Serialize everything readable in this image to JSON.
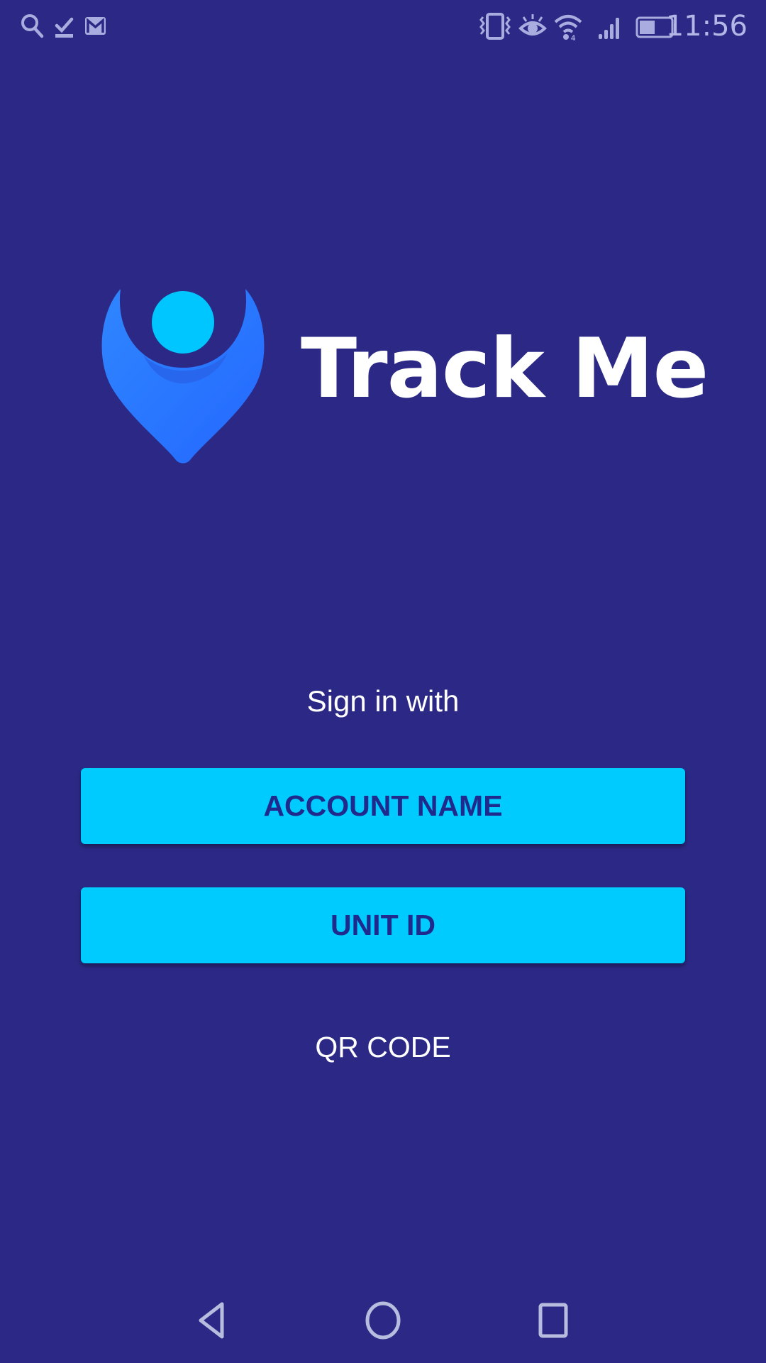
{
  "status_bar": {
    "left_icons": [
      "search-icon",
      "task-check-icon",
      "gmail-icon"
    ],
    "right_icons": [
      "vibrate-icon",
      "eye-comfort-icon",
      "wifi-icon",
      "signal-icon",
      "battery-icon"
    ],
    "battery_level": 0.5,
    "time": "11:56"
  },
  "brand": {
    "app_name": "Track Me",
    "logo_icon": "location-pin-person-icon",
    "colors": {
      "background": "#2b2985",
      "pin": "#2979ff",
      "head": "#00c6ff",
      "button": "#00cbff",
      "button_text": "#1f2a8c"
    }
  },
  "signin": {
    "label": "Sign in with",
    "buttons": [
      {
        "label": "ACCOUNT NAME"
      },
      {
        "label": "UNIT ID"
      }
    ],
    "qr_link": "QR CODE"
  },
  "nav_bar": {
    "buttons": [
      "back",
      "home",
      "recents"
    ]
  }
}
